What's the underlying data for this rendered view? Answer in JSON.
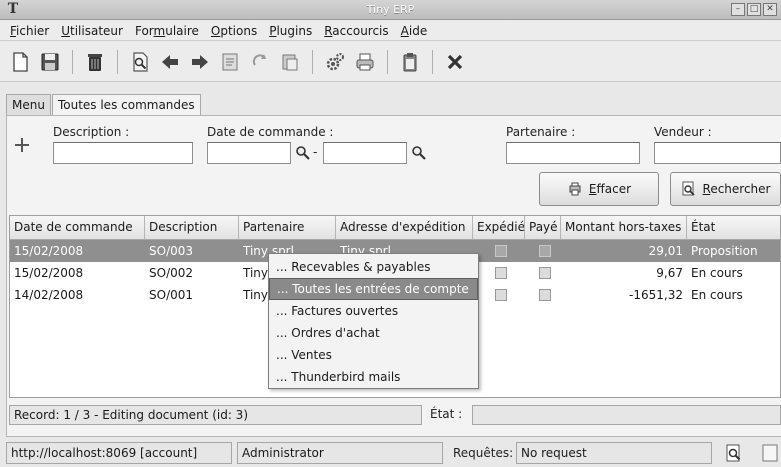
{
  "window": {
    "title": "Tiny ERP",
    "app_icon": "T"
  },
  "menubar": [
    {
      "pre": "",
      "u": "F",
      "post": "ichier"
    },
    {
      "pre": "",
      "u": "U",
      "post": "tilisateur"
    },
    {
      "pre": "For",
      "u": "m",
      "post": "ulaire"
    },
    {
      "pre": "",
      "u": "O",
      "post": "ptions"
    },
    {
      "pre": "",
      "u": "P",
      "post": "lugins"
    },
    {
      "pre": "",
      "u": "R",
      "post": "accourcis"
    },
    {
      "pre": "",
      "u": "A",
      "post": "ide"
    }
  ],
  "toolbar_icons": [
    "new-document-icon",
    "save-icon",
    "delete-icon",
    "find-icon",
    "previous-icon",
    "next-icon",
    "switch-view-icon",
    "reload-icon",
    "attachment-icon",
    "action-icon",
    "print-icon",
    "copy-icon",
    "close-icon"
  ],
  "tabs": [
    "Menu",
    "Toutes les commandes"
  ],
  "search": {
    "description_label": "Description :",
    "description_value": "",
    "date_label": "Date de commande :",
    "date_from": "",
    "date_sep": "-",
    "date_to": "",
    "partner_label": "Partenaire :",
    "partner_value": "",
    "seller_label": "Vendeur :",
    "seller_value": "",
    "clear_btn": {
      "pre": "",
      "u": "E",
      "post": "ffacer"
    },
    "search_btn": {
      "pre": "",
      "u": "R",
      "post": "echercher"
    }
  },
  "grid": {
    "columns": [
      "Date de commande",
      "Description",
      "Partenaire",
      "Adresse d'expédition",
      "Expédié",
      "Payé",
      "Montant hors-taxes",
      "État"
    ],
    "rows": [
      {
        "date": "15/02/2008",
        "desc": "SO/003",
        "partner": "Tiny sprl",
        "address": "Tiny sprl",
        "shipped": false,
        "paid": false,
        "amount": "29,01",
        "state": "Proposition",
        "selected": true
      },
      {
        "date": "15/02/2008",
        "desc": "SO/002",
        "partner": "Tiny",
        "address": "",
        "shipped": false,
        "paid": false,
        "amount": "9,67",
        "state": "En cours",
        "selected": false
      },
      {
        "date": "14/02/2008",
        "desc": "SO/001",
        "partner": "Tiny",
        "address": "",
        "shipped": false,
        "paid": false,
        "amount": "-1651,32",
        "state": "En cours",
        "selected": false
      }
    ]
  },
  "context_menu": [
    "... Recevables & payables",
    "... Toutes les entrées de compte",
    "... Factures ouvertes",
    "... Ordres d'achat",
    "... Ventes",
    "... Thunderbird mails"
  ],
  "context_menu_hover_index": 1,
  "status": {
    "record": "Record: 1 / 3 - Editing document (id: 3)",
    "state_label": "État :",
    "state_value": ""
  },
  "bottom": {
    "server": "http://localhost:8069 [account]",
    "user": "Administrator",
    "requests_label": "Requêtes:",
    "requests_value": "No request"
  }
}
